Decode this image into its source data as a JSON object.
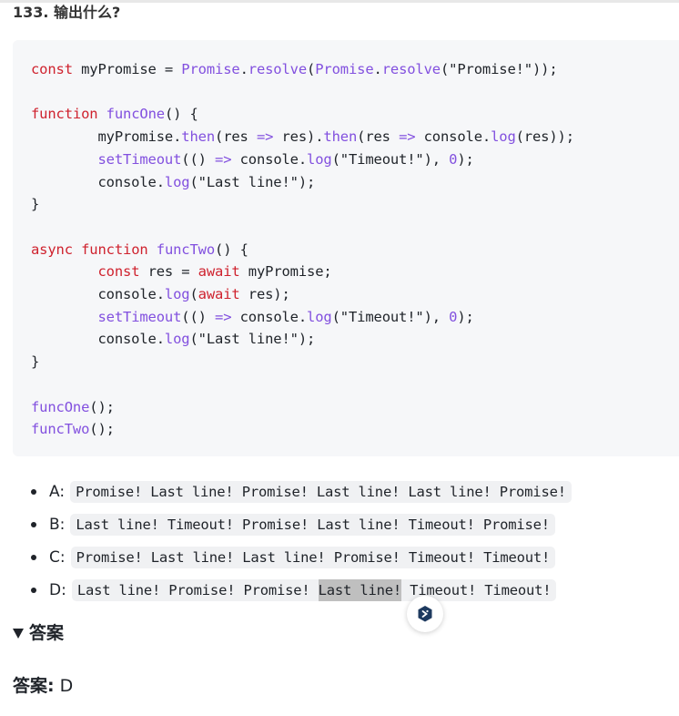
{
  "question": {
    "title": "133. 输出什么?"
  },
  "code_lines": [
    "const myPromise = Promise.resolve(Promise.resolve(\"Promise!\"));",
    "",
    "function funcOne() {",
    "        myPromise.then(res => res).then(res => console.log(res));",
    "        setTimeout(() => console.log(\"Timeout!\"), 0);",
    "        console.log(\"Last line!\");",
    "}",
    "",
    "async function funcTwo() {",
    "        const res = await myPromise;",
    "        console.log(await res);",
    "        setTimeout(() => console.log(\"Timeout!\"), 0);",
    "        console.log(\"Last line!\");",
    "}",
    "",
    "funcOne();",
    "funcTwo();"
  ],
  "options": [
    {
      "letter": "A:",
      "text": "Promise! Last line! Promise! Last line! Last line! Promise!"
    },
    {
      "letter": "B:",
      "text": "Last line! Timeout! Promise! Last line! Timeout! Promise!"
    },
    {
      "letter": "C:",
      "text": "Promise! Last line! Last line! Promise! Timeout! Timeout!"
    },
    {
      "letter": "D:",
      "text_before": "Last line! Promise! Promise! ",
      "text_highlight": "Last line!",
      "text_after": " Timeout! Timeout!"
    }
  ],
  "answer": {
    "toggle_label": "答案",
    "label": "答案:",
    "value": "D"
  },
  "colors": {
    "keyword": "#cf222e",
    "function": "#8250df",
    "code_bg": "#f6f7f9",
    "fab_icon": "#1e3a5f"
  },
  "icons": {
    "fab": "deepl-translate-icon",
    "toggle": "triangle-down-icon"
  }
}
